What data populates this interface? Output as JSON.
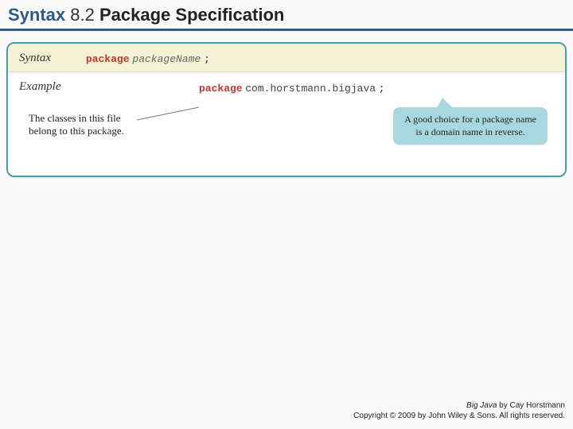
{
  "header": {
    "prefix": "Syntax",
    "number": "8.2",
    "title": "Package Specification"
  },
  "syntax": {
    "label": "Syntax",
    "keyword": "package",
    "placeholder": "packageName",
    "terminator": ";"
  },
  "example": {
    "label": "Example",
    "keyword": "package",
    "package_name": "com.horstmann.bigjava",
    "terminator": ";"
  },
  "annotations": {
    "left_line1": "The classes in this file",
    "left_line2": "belong to this package.",
    "right_line1": "A good choice for a package name",
    "right_line2": "is a domain name in reverse."
  },
  "footer": {
    "book": "Big Java",
    "byline": " by Cay Horstmann",
    "copyright": "Copyright © 2009 by John Wiley & Sons.  All rights reserved."
  }
}
